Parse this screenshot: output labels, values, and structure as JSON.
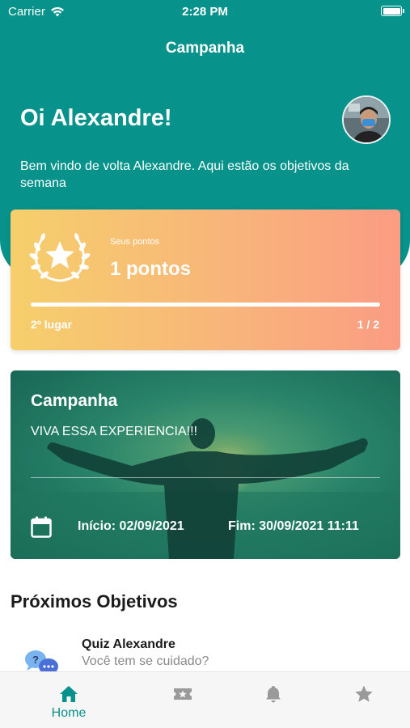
{
  "status_bar": {
    "carrier": "Carrier",
    "time": "2:28 PM"
  },
  "nav": {
    "title": "Campanha"
  },
  "header": {
    "greeting": "Oi Alexandre!",
    "welcome": "Bem vindo de volta Alexandre. Aqui estão os objetivos da semana"
  },
  "points_card": {
    "label": "Seus pontos",
    "points": "1 pontos",
    "rank": "2º lugar",
    "rank_count": "1 / 2",
    "progress_percent": 100
  },
  "campaign_card": {
    "title": "Campanha",
    "subtitle": "VIVA ESSA EXPERIENCIA!!!",
    "start": "Início: 02/09/2021",
    "end": "Fim: 30/09/2021 11:11"
  },
  "objectives": {
    "section_title": "Próximos Objetivos",
    "items": [
      {
        "title": "Quiz Alexandre",
        "description": "Você tem se cuidado?",
        "icon": "quiz-chat-icon"
      }
    ]
  },
  "tab_bar": {
    "items": [
      {
        "label": "Home",
        "icon": "home-icon",
        "active": true
      },
      {
        "label": "",
        "icon": "ticket-star-icon",
        "active": false
      },
      {
        "label": "",
        "icon": "bell-icon",
        "active": false
      },
      {
        "label": "",
        "icon": "star-icon",
        "active": false
      }
    ]
  },
  "colors": {
    "primary_teal": "#07928b",
    "points_gradient_start": "#f6cf6b",
    "points_gradient_end": "#fb9c83",
    "inactive_tab": "#9a9a9a"
  }
}
